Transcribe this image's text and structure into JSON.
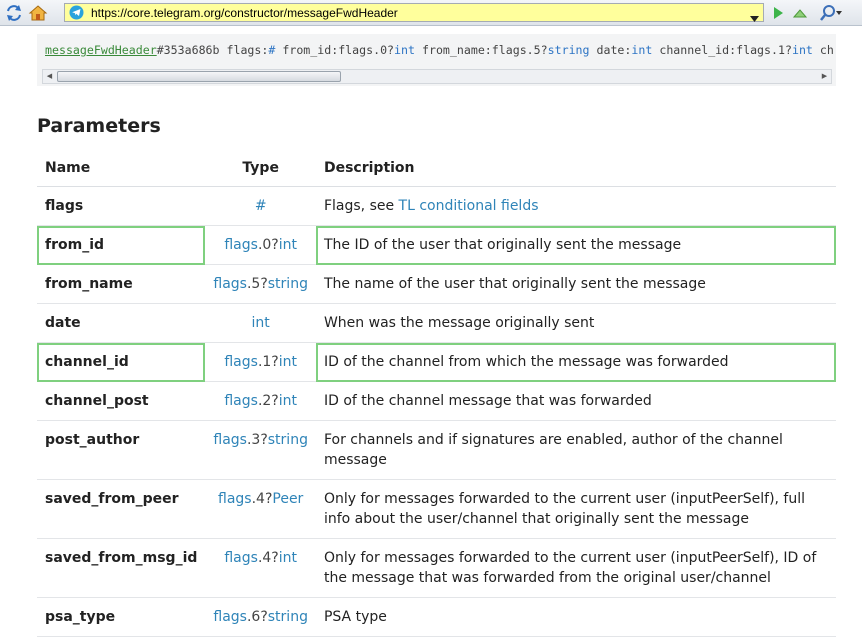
{
  "browser": {
    "url": "https://core.telegram.org/constructor/messageFwdHeader"
  },
  "code": {
    "constructor": "messageFwdHeader",
    "id": "#353a686b",
    "parts": [
      {
        "text": " flags:",
        "kw": false
      },
      {
        "text": "#",
        "kw": true
      },
      {
        "text": " from_id:flags.0?",
        "kw": false
      },
      {
        "text": "int",
        "kw": true
      },
      {
        "text": " from_name:flags.5?",
        "kw": false
      },
      {
        "text": "string",
        "kw": true
      },
      {
        "text": " date:",
        "kw": false
      },
      {
        "text": "int",
        "kw": true
      },
      {
        "text": " channel_id:flags.1?",
        "kw": false
      },
      {
        "text": "int",
        "kw": true
      },
      {
        "text": " ch",
        "kw": false
      }
    ]
  },
  "heading": "Parameters",
  "table": {
    "headers": {
      "name": "Name",
      "type": "Type",
      "description": "Description"
    },
    "rows": [
      {
        "name": "flags",
        "type": "#",
        "type_flag": "",
        "type_base": "#",
        "description": "Flags, see ",
        "desc_link": "TL conditional fields",
        "highlighted": false
      },
      {
        "name": "from_id",
        "type_flag": "flags.0?",
        "type_base": "int",
        "description": "The ID of the user that originally sent the message",
        "desc_link": "",
        "highlighted": true
      },
      {
        "name": "from_name",
        "type_flag": "flags.5?",
        "type_base": "string",
        "description": "The name of the user that originally sent the message",
        "desc_link": "",
        "highlighted": false
      },
      {
        "name": "date",
        "type_flag": "",
        "type_base": "int",
        "description": "When was the message originally sent",
        "desc_link": "",
        "highlighted": false
      },
      {
        "name": "channel_id",
        "type_flag": "flags.1?",
        "type_base": "int",
        "description": "ID of the channel from which the message was forwarded",
        "desc_link": "",
        "highlighted": true
      },
      {
        "name": "channel_post",
        "type_flag": "flags.2?",
        "type_base": "int",
        "description": "ID of the channel message that was forwarded",
        "desc_link": "",
        "highlighted": false
      },
      {
        "name": "post_author",
        "type_flag": "flags.3?",
        "type_base": "string",
        "description": "For channels and if signatures are enabled, author of the channel message",
        "desc_link": "",
        "highlighted": false
      },
      {
        "name": "saved_from_peer",
        "type_flag": "flags.4?",
        "type_base": "Peer",
        "description": "Only for messages forwarded to the current user (inputPeerSelf), full info about the user/channel that originally sent the message",
        "desc_link": "",
        "highlighted": false
      },
      {
        "name": "saved_from_msg_id",
        "type_flag": "flags.4?",
        "type_base": "int",
        "description": "Only for messages forwarded to the current user (inputPeerSelf), ID of the message that was forwarded from the original user/channel",
        "desc_link": "",
        "highlighted": false
      },
      {
        "name": "psa_type",
        "type_flag": "flags.6?",
        "type_base": "string",
        "description": "PSA type",
        "desc_link": "",
        "highlighted": false
      }
    ]
  },
  "colors": {
    "link": "#2f84b8",
    "constructor": "#3a8a3a",
    "highlight_border": "#7fd07f",
    "url_bar": "#ffff9c"
  },
  "icons": [
    "refresh-icon",
    "home-icon",
    "telegram-icon",
    "dropdown-icon",
    "go-icon",
    "up-icon",
    "search-icon"
  ]
}
